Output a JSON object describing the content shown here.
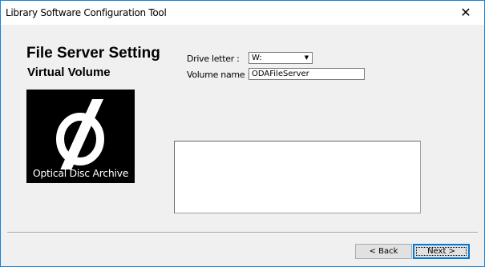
{
  "window": {
    "title": "Library Software Configuration Tool",
    "close_glyph": "✕"
  },
  "page": {
    "heading": "File Server Setting",
    "subheading": "Virtual Volume"
  },
  "logo": {
    "icon": "optical-disc-archive-logo",
    "text": "Optical Disc Archive"
  },
  "form": {
    "drive_letter_label": "Drive letter :",
    "drive_letter_value": "W:",
    "volume_name_label": "Volume name :",
    "volume_name_value": "ODAFileServer"
  },
  "buttons": {
    "back_label": "< Back",
    "next_label": "Next >"
  },
  "colors": {
    "window_border": "#1883d7",
    "default_button_border": "#0078d7"
  }
}
